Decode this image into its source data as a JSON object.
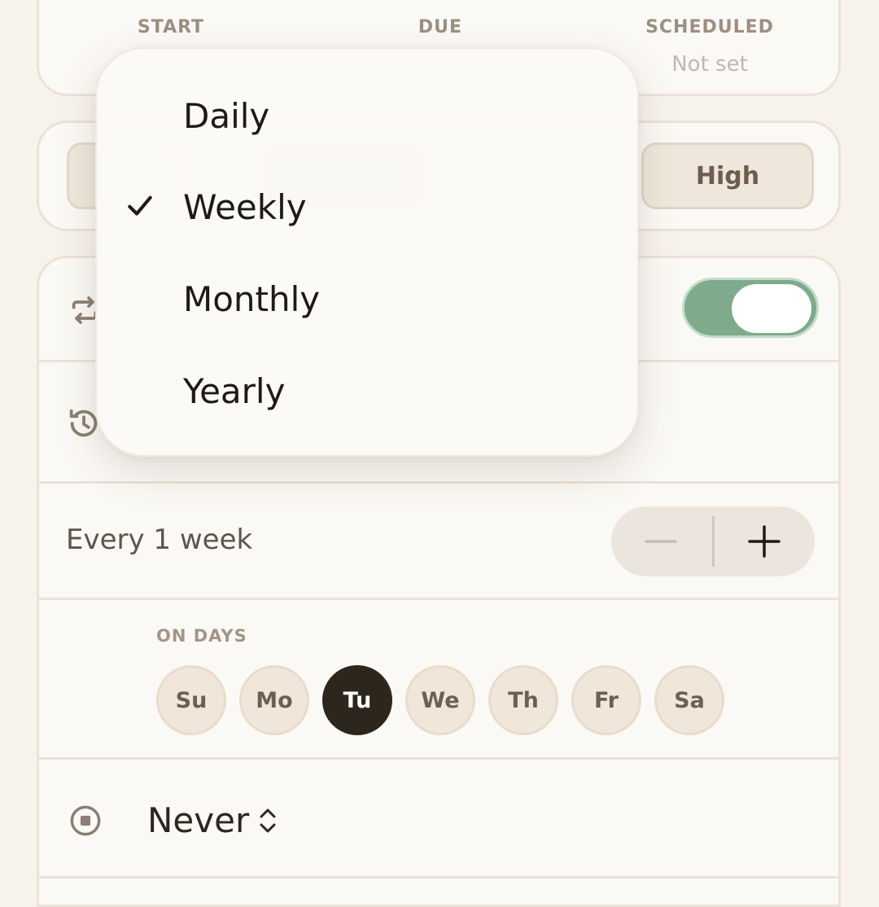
{
  "dates": {
    "start_label": "START",
    "due_label": "DUE",
    "scheduled_label": "SCHEDULED",
    "scheduled_value": "Not set"
  },
  "priority": {
    "high_label": "High"
  },
  "recurrence": {
    "enabled": true,
    "interval_label": "Every 1 week",
    "on_days_label": "ON DAYS",
    "days": [
      {
        "label": "Su",
        "selected": false
      },
      {
        "label": "Mo",
        "selected": false
      },
      {
        "label": "Tu",
        "selected": true
      },
      {
        "label": "We",
        "selected": false
      },
      {
        "label": "Th",
        "selected": false
      },
      {
        "label": "Fr",
        "selected": false
      },
      {
        "label": "Sa",
        "selected": false
      }
    ],
    "end_value": "Never"
  },
  "frequency_menu": {
    "items": [
      {
        "label": "Daily",
        "checked": false
      },
      {
        "label": "Weekly",
        "checked": true
      },
      {
        "label": "Monthly",
        "checked": false
      },
      {
        "label": "Yearly",
        "checked": false
      }
    ]
  },
  "icons": {
    "repeat": "repeat-icon",
    "history": "history-icon",
    "end": "stop-circle-icon",
    "check": "checkmark-icon",
    "chevron": "chevron-up-down-icon"
  },
  "colors": {
    "accent_toggle": "#7faa8c",
    "selected_day": "#2d261d",
    "background": "#f7f3ec"
  }
}
